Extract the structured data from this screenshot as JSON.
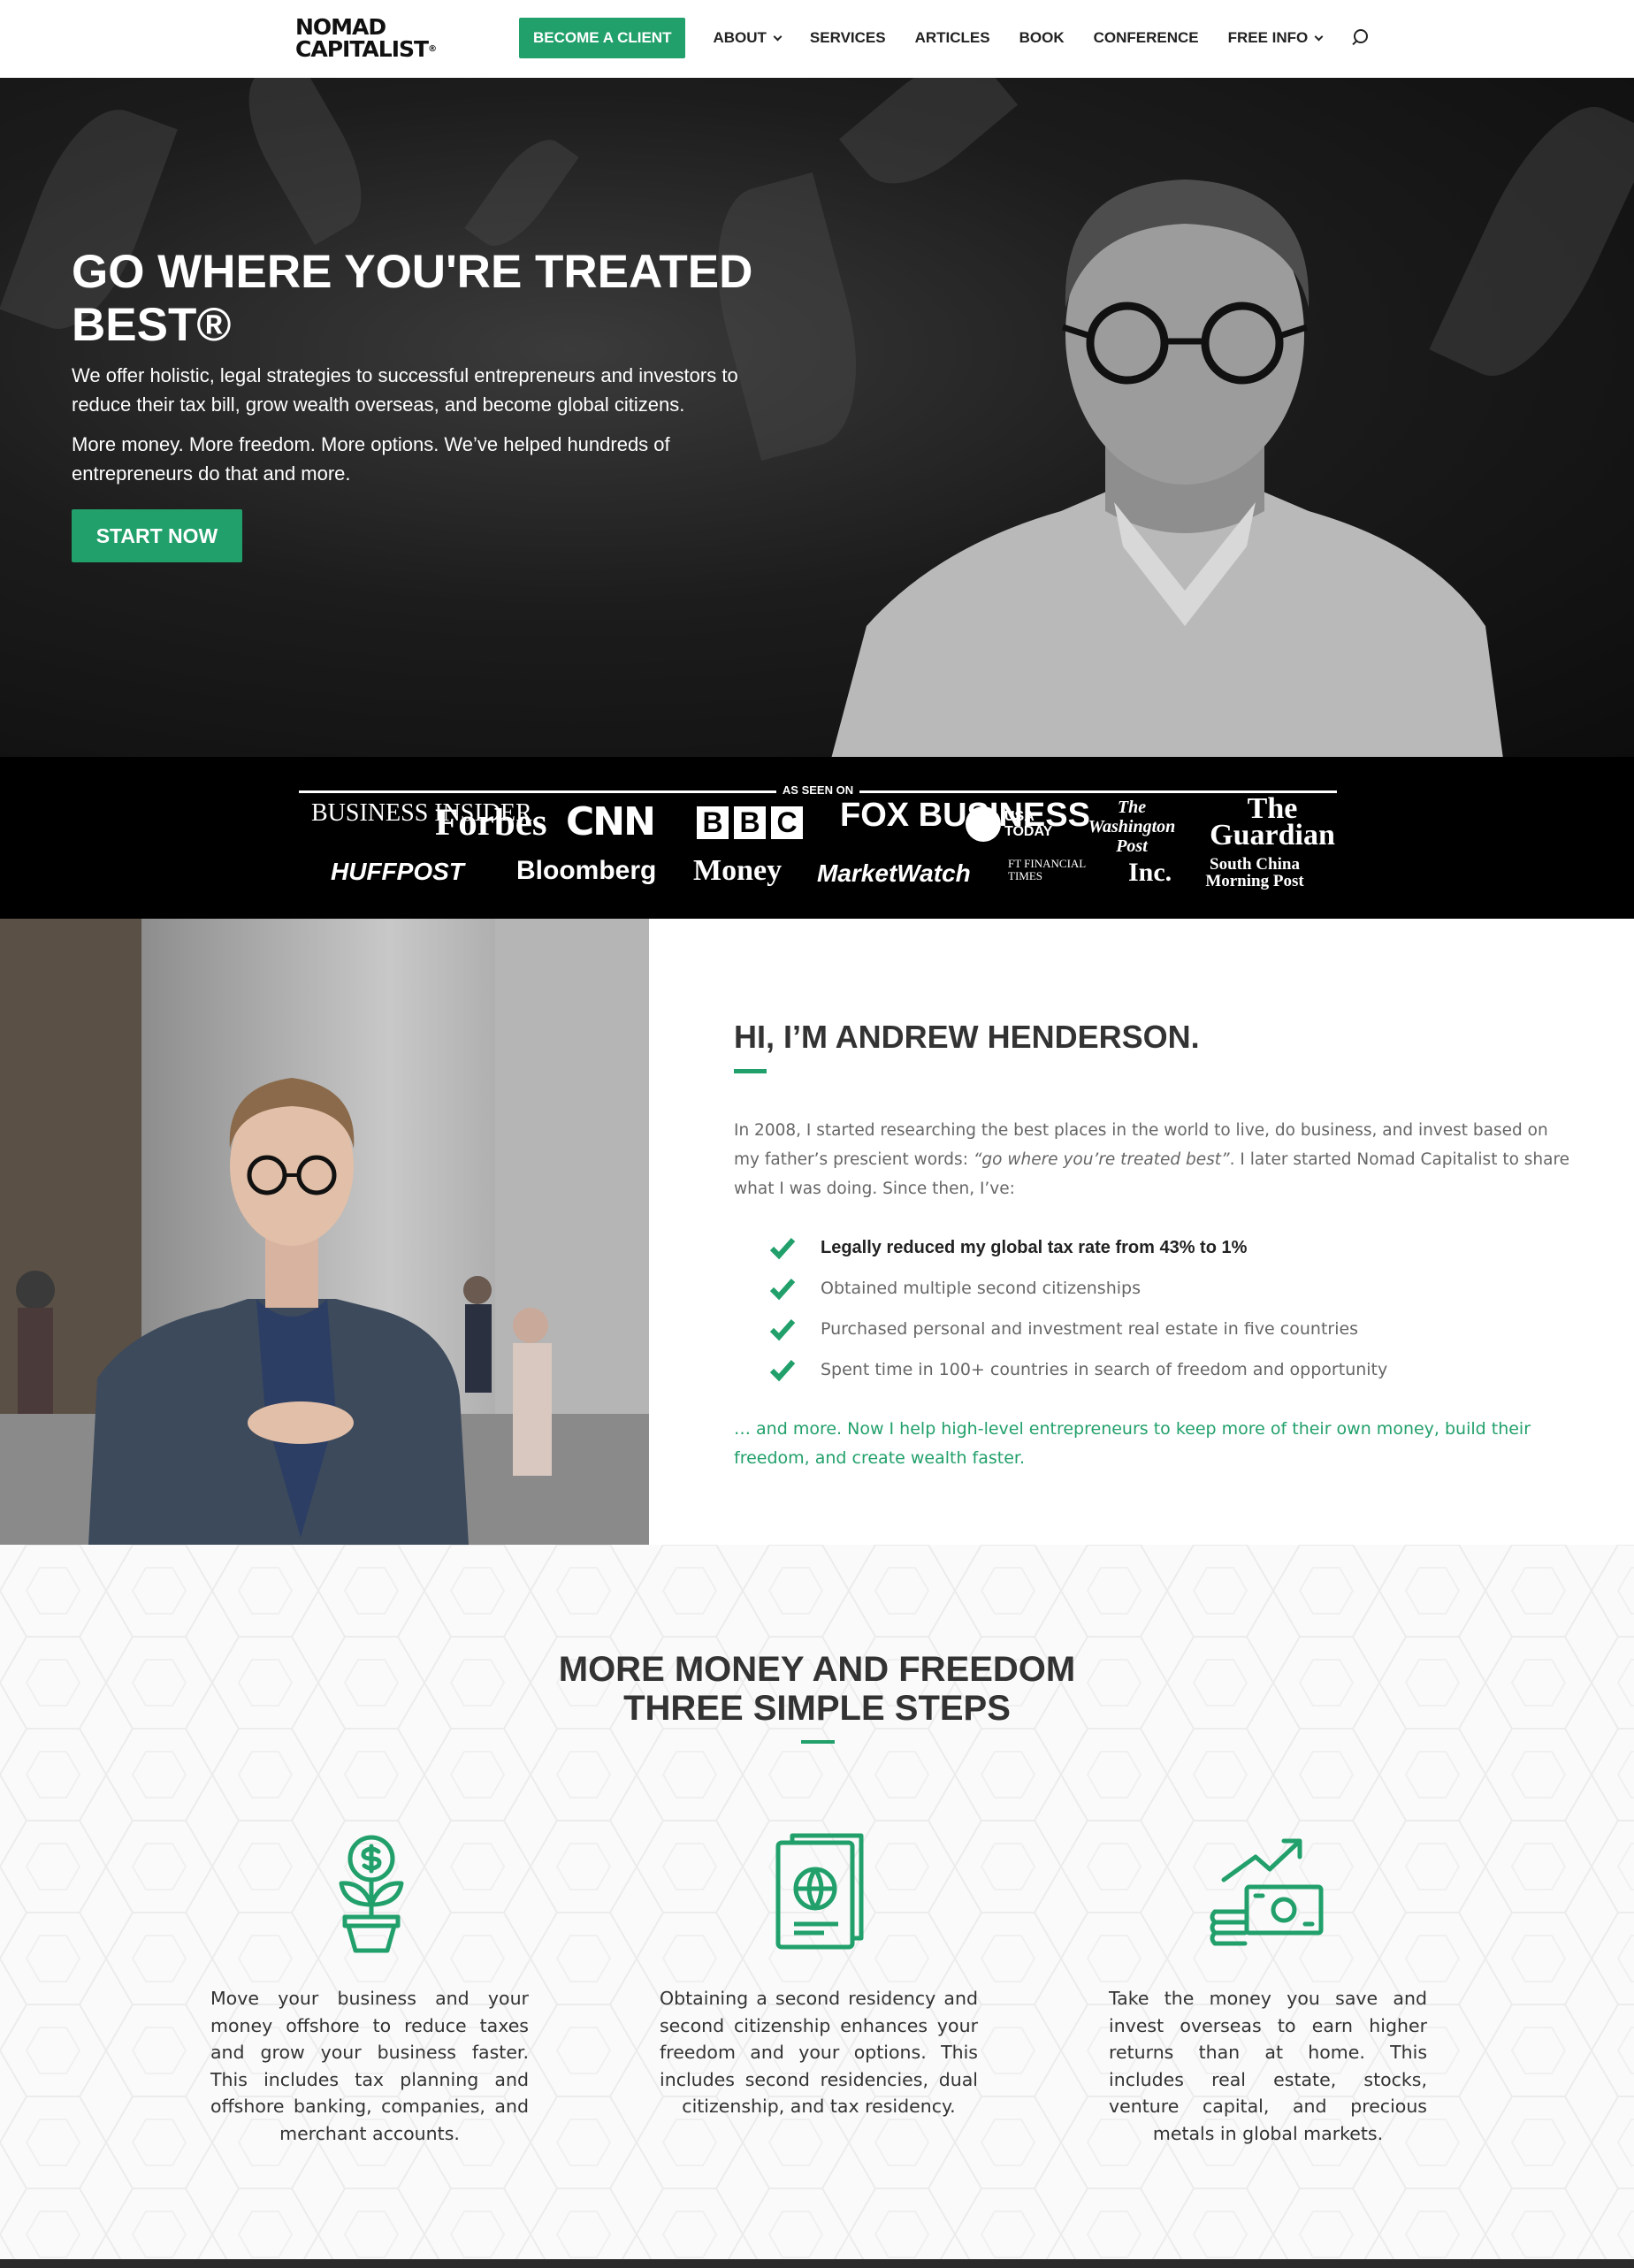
{
  "header": {
    "logo_line1": "NOMAD",
    "logo_line2": "CAPITALIST",
    "logo_reg": "®",
    "cta_label": "BECOME A CLIENT",
    "nav": [
      "ABOUT",
      "SERVICES",
      "ARTICLES",
      "BOOK",
      "CONFERENCE",
      "FREE INFO"
    ],
    "icons": [
      "chevron-down-icon",
      "search-icon"
    ]
  },
  "hero": {
    "title": "GO WHERE YOU'RE TREATED BEST®",
    "paragraph1": "We offer holistic, legal strategies to successful entrepreneurs and investors to reduce their tax bill, grow wealth overseas, and become global citizens.",
    "paragraph2": "More money. More freedom. More options. We’ve helped hundreds of entrepreneurs do that and more.",
    "button_label": "START NOW"
  },
  "press": {
    "label": "AS SEEN ON",
    "logos": [
      "BUSINESS INSIDER",
      "Forbes",
      "CNN",
      "BBC",
      "FOX BUSINESS",
      "USA TODAY",
      "The Washington Post",
      "The Guardian",
      "HUFFPOST",
      "Bloomberg",
      "Money",
      "MarketWatch",
      "FT FINANCIAL TIMES",
      "Inc.",
      "South China Morning Post"
    ]
  },
  "about": {
    "title": "HI, I’M ANDREW HENDERSON.",
    "intro_part1": "In 2008, I started researching the best places in the world to live, do business, and invest based on my father’s prescient words: ",
    "intro_quote": "“go where you’re treated best”",
    "intro_part2": ". I later started Nomad Capitalist to share what I was doing. Since then, I’ve:",
    "checks": [
      "Legally reduced my global tax rate from 43% to 1%",
      "Obtained multiple second citizenships",
      "Purchased personal and investment real estate in five countries",
      "Spent time in 100+ countries in search of freedom and opportunity"
    ],
    "outro": "… and more. Now I help high-level entrepreneurs to keep more of their own money, build their freedom, and create wealth faster."
  },
  "steps": {
    "title_line1": "MORE MONEY AND FREEDOM",
    "title_line2": "THREE SIMPLE STEPS",
    "items": [
      {
        "icon": "money-plant-icon",
        "text": "Move your business and your money offshore to reduce taxes and grow your business faster. This includes tax planning and offshore banking, companies, and merchant accounts."
      },
      {
        "icon": "passport-icon",
        "text": "Obtaining a second residency and second citizenship enhances your freedom and your options. This includes second residencies, dual citizenship, and tax residency."
      },
      {
        "icon": "money-growth-icon",
        "text": "Take the money you save and invest overseas to earn higher returns than at home. This includes real estate, stocks, venture capital, and precious metals in global markets."
      }
    ]
  },
  "colors": {
    "accent": "#22a06b",
    "text": "#333333",
    "muted": "#666666",
    "press_bg": "#000000"
  }
}
